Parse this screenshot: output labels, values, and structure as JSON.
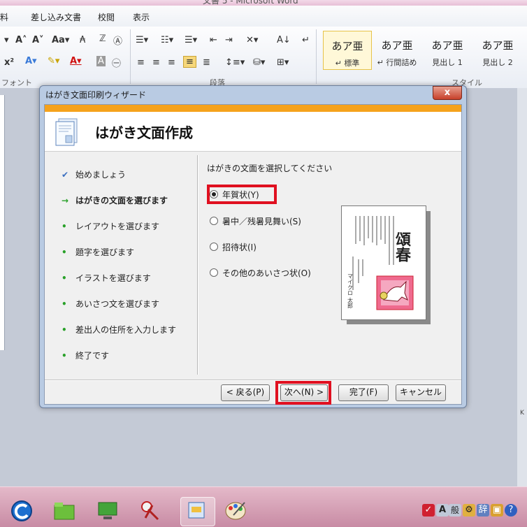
{
  "window": {
    "title": "文書 5 - Microsoft Word"
  },
  "menu": {
    "tabs": [
      "料",
      "差し込み文書",
      "校閲",
      "表示"
    ]
  },
  "ribbon": {
    "groups": {
      "font": "フォント",
      "paragraph": "段落",
      "styles": "スタイル"
    },
    "styles": [
      {
        "sample": "あア亜",
        "name": "↵ 標準"
      },
      {
        "sample": "あア亜",
        "name": "↵ 行間詰め"
      },
      {
        "sample": "あア亜",
        "name": "見出し 1"
      },
      {
        "sample": "あア亜",
        "name": "見出し 2"
      }
    ]
  },
  "dialog": {
    "title": "はがき文面印刷ウィザード",
    "close_label": "x",
    "header_title": "はがき文面作成",
    "steps": [
      {
        "label": "始めましょう",
        "mark": "✔"
      },
      {
        "label": "はがきの文面を選びます",
        "mark": "→"
      },
      {
        "label": "レイアウトを選びます",
        "mark": "•"
      },
      {
        "label": "題字を選びます",
        "mark": "•"
      },
      {
        "label": "イラストを選びます",
        "mark": "•"
      },
      {
        "label": "あいさつ文を選びます",
        "mark": "•"
      },
      {
        "label": "差出人の住所を入力します",
        "mark": "•"
      },
      {
        "label": "終了です",
        "mark": "•"
      }
    ],
    "prompt": "はがきの文面を選択してください",
    "options": [
      {
        "label": "年賀状(Y)",
        "checked": true
      },
      {
        "label": "暑中／残暑見舞い(S)",
        "checked": false
      },
      {
        "label": "招待状(I)",
        "checked": false
      },
      {
        "label": "その他のあいさつ状(O)",
        "checked": false
      }
    ],
    "preview": {
      "title_text": "頌春",
      "sender": "マイクロ 太郎"
    },
    "buttons": {
      "back": "< 戻る(P)",
      "next": "次へ(N) >",
      "finish": "完了(F)",
      "cancel": "キャンセル"
    }
  },
  "status": {
    "edge_label": "K"
  },
  "colors": {
    "accent_orange": "#f5a21c",
    "highlight_red": "#e01020",
    "taskbar_pink": "#d9a2b8"
  }
}
